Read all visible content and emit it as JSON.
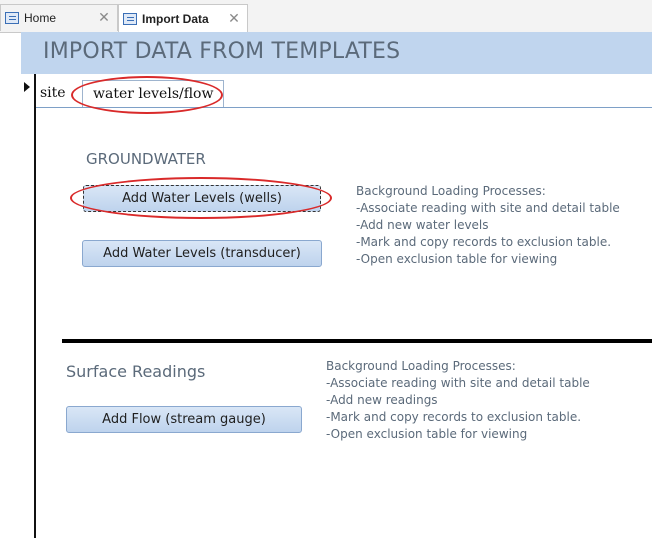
{
  "doc_tabs": [
    {
      "label": "Home"
    },
    {
      "label": "Import Data"
    }
  ],
  "header": {
    "title": "IMPORT DATA FROM TEMPLATES"
  },
  "page_tabs": [
    {
      "label": "site"
    },
    {
      "label": "water levels/flow"
    }
  ],
  "groundwater": {
    "title": "GROUNDWATER",
    "buttons": [
      {
        "label": "Add Water Levels (wells)"
      },
      {
        "label": "Add Water Levels (transducer)"
      }
    ],
    "processes": [
      "Background Loading Processes:",
      "-Associate reading with site and detail table",
      "-Add new water levels",
      "-Mark and copy records to exclusion table.",
      "-Open exclusion table for viewing"
    ]
  },
  "surface": {
    "title": "Surface Readings",
    "buttons": [
      {
        "label": "Add Flow (stream gauge)"
      }
    ],
    "processes": [
      "Background Loading Processes:",
      "-Associate reading with site and detail table",
      "-Add new readings",
      "-Mark and copy records to exclusion table.",
      "-Open exclusion table for viewing"
    ]
  },
  "colors": {
    "header_bg": "#c0d5ee",
    "annotation": "#d92a2a",
    "button_bg": "#cddff3"
  },
  "icons": [
    "form-icon",
    "close-icon",
    "record-arrow-icon"
  ]
}
